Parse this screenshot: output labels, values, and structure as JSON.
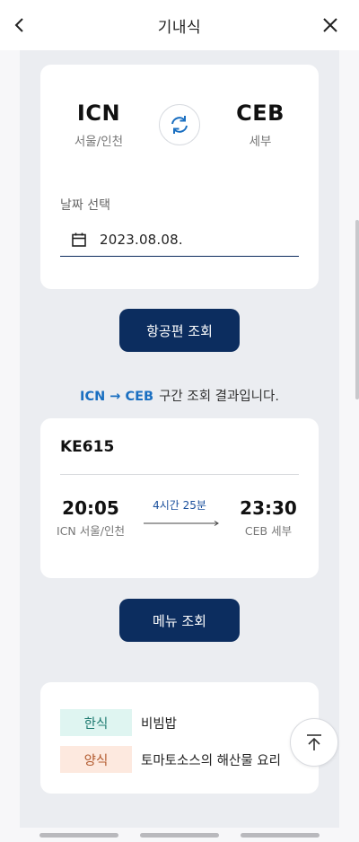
{
  "header": {
    "title": "기내식",
    "back_icon": "chevron-left-icon",
    "close_icon": "close-icon"
  },
  "route": {
    "departure": {
      "code": "ICN",
      "city": "서울/인천"
    },
    "arrival": {
      "code": "CEB",
      "city": "세부"
    },
    "swap_icon": "swap-arrows-icon",
    "date_label": "날짜 선택",
    "date_value": "2023.08.08.",
    "calendar_icon": "calendar-icon"
  },
  "search_button": "항공편 조회",
  "result": {
    "route": "ICN → CEB",
    "message": "구간 조회 결과입니다."
  },
  "flight": {
    "number": "KE615",
    "departure_time": "20:05",
    "departure_place": "ICN 서울/인천",
    "duration": "4시간 25분",
    "arrival_time": "23:30",
    "arrival_place": "CEB 세부"
  },
  "menu_button": "메뉴 조회",
  "menu": [
    {
      "category": "한식",
      "dish": "비빔밥"
    },
    {
      "category": "양식",
      "dish": "토마토소스의 해산물 요리"
    }
  ],
  "colors": {
    "primary": "#0c2d5f",
    "link_blue": "#1a6fc1",
    "korean_badge_bg": "#dff5f1",
    "western_badge_bg": "#fde9df"
  },
  "scroll_top_icon": "arrow-up-to-top-icon"
}
